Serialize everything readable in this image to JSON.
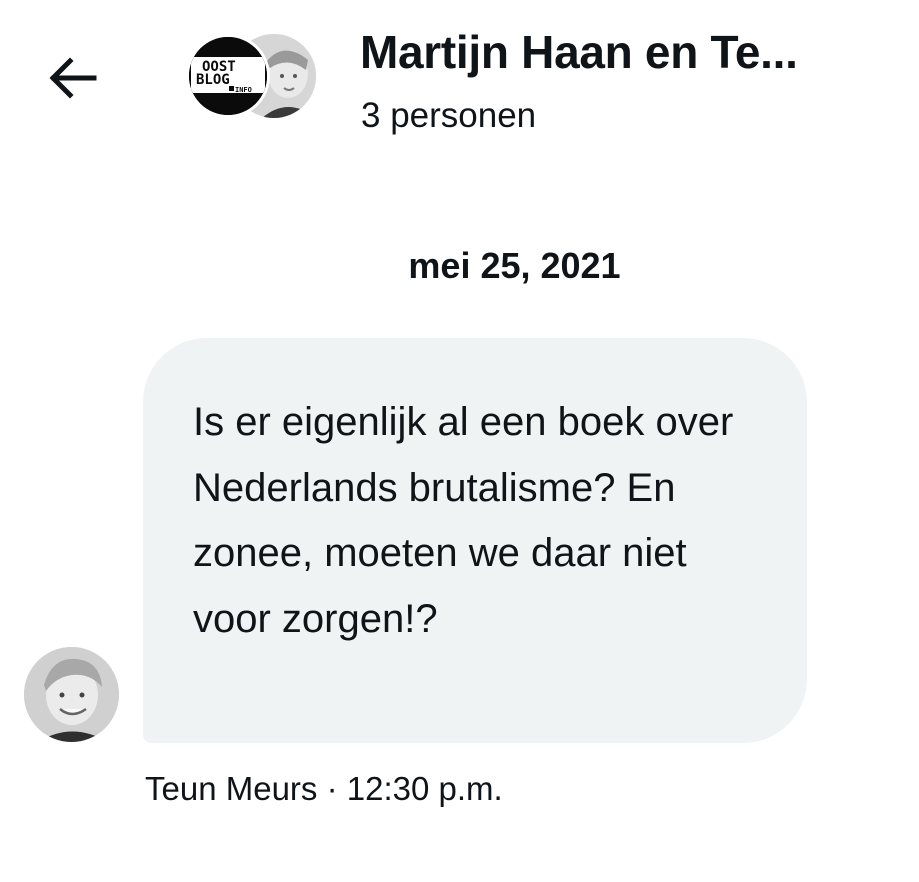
{
  "header": {
    "back_icon": "arrow-left-icon",
    "title": "Martijn Haan en Te...",
    "subtitle": "3 personen",
    "group_avatar": {
      "logo_lines": [
        "OOST",
        "BLOG",
        "INFO"
      ]
    }
  },
  "conversation": {
    "date": "mei 25, 2021",
    "messages": [
      {
        "text": "Is er eigenlijk al een boek over Nederlands brutalisme? En zonee, moeten we daar niet voor zorgen!?",
        "sender": "Teun Meurs",
        "separator": "·",
        "time": "12:30 p.m."
      }
    ]
  },
  "colors": {
    "bubble": "#eff3f4",
    "text": "#0f1419",
    "background": "#ffffff"
  }
}
